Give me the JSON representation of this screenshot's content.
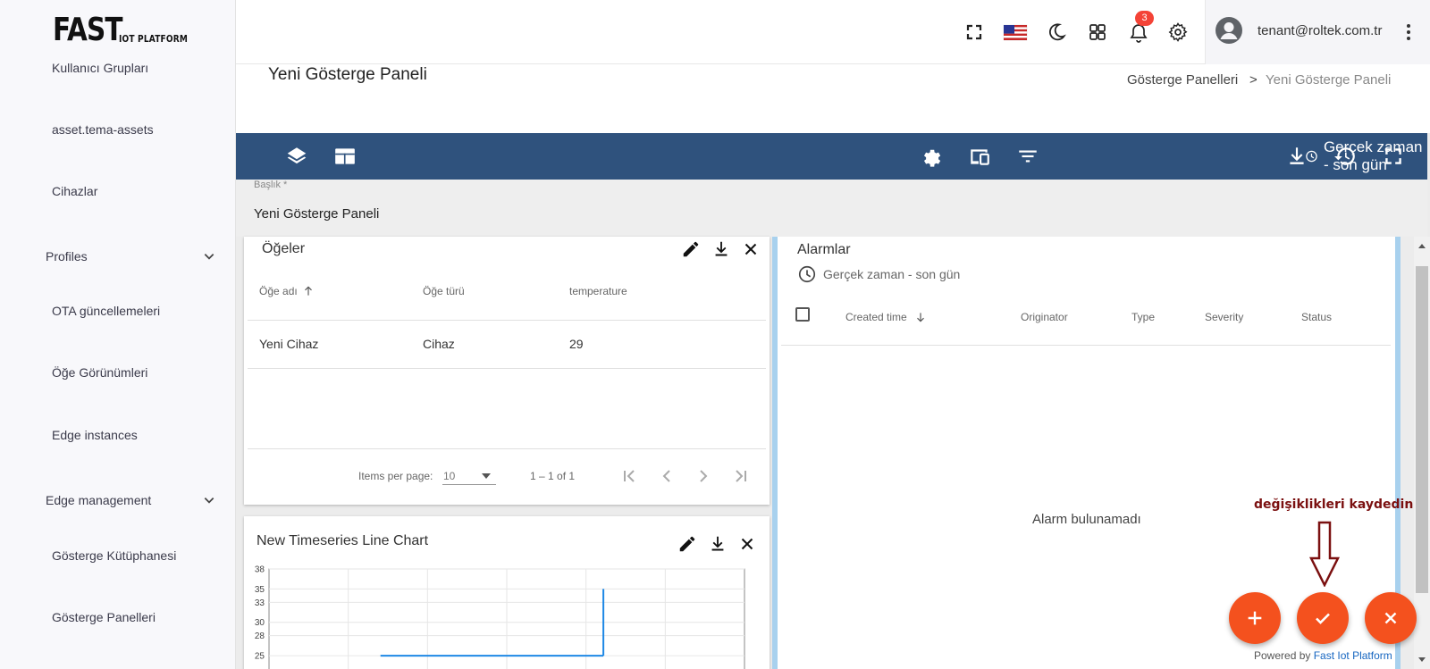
{
  "brand": {
    "logo_big": "FAST",
    "logo_small": "IOT PLATFORM"
  },
  "sidebar": {
    "items": [
      {
        "label": "Kullanıcı Grupları"
      },
      {
        "label": "asset.tema-assets"
      },
      {
        "label": "Cihazlar"
      },
      {
        "label": "Profiles"
      },
      {
        "label": "OTA güncellemeleri"
      },
      {
        "label": "Öğe Görünümleri"
      },
      {
        "label": "Edge instances"
      },
      {
        "label": "Edge management"
      },
      {
        "label": "Gösterge Kütüphanesi"
      },
      {
        "label": "Gösterge Panelleri"
      }
    ]
  },
  "topbar": {
    "icons": [
      "fullscreen-icon",
      "us-flag-icon",
      "moon-icon",
      "apps-grid-icon",
      "bell-icon",
      "gear-icon"
    ],
    "notification_count": "3",
    "user_email": "tenant@roltek.com.tr"
  },
  "page": {
    "title": "Yeni Gösterge Paneli",
    "breadcrumb": [
      "Gösterge Panelleri",
      ">",
      "Yeni Gösterge Paneli"
    ]
  },
  "dashboard_toolbar": {
    "timewindow": "Gerçek zaman - son gün",
    "color": "#2f527d"
  },
  "title_field": {
    "label": "Başlık *",
    "value": "Yeni Gösterge Paneli"
  },
  "entities_widget": {
    "title": "Öğeler",
    "columns": [
      "Öğe adı",
      "Öğe türü",
      "temperature"
    ],
    "rows": [
      [
        "Yeni Cihaz",
        "Cihaz",
        "29"
      ]
    ],
    "pager": {
      "items_per_page_label": "Items per page:",
      "items_per_page": "10",
      "range": "1 – 1 of 1"
    }
  },
  "alarms_widget": {
    "title": "Alarmlar",
    "timewindow": "Gerçek zaman - son gün",
    "columns": [
      "Created time",
      "Originator",
      "Type",
      "Severity",
      "Status"
    ],
    "empty_text": "Alarm bulunamadı"
  },
  "chart_widget": {
    "title": "New Timeseries Line Chart"
  },
  "chart_data": {
    "type": "line",
    "y_ticks": [
      "38",
      "35",
      "33",
      "30",
      "28",
      "25"
    ],
    "ylim": [
      23,
      38
    ],
    "series": [
      {
        "x": [
          0,
          1,
          2,
          3
        ],
        "values": [
          25,
          25,
          25,
          25
        ]
      },
      {
        "x": [
          3,
          3
        ],
        "values": [
          25,
          35
        ]
      }
    ],
    "xlim": [
      -1.5,
      4.9
    ],
    "grid": true,
    "line_color": "#1e88e5"
  },
  "annotation": {
    "text": "değişiklikleri kaydedin",
    "color": "#7b1010"
  },
  "fabs": {
    "add": "add-icon",
    "save": "check-icon",
    "cancel": "close-icon",
    "color": "#f4511e"
  },
  "footer": {
    "powered_by": "Powered by",
    "brand_link": "Fast Iot Platform"
  }
}
